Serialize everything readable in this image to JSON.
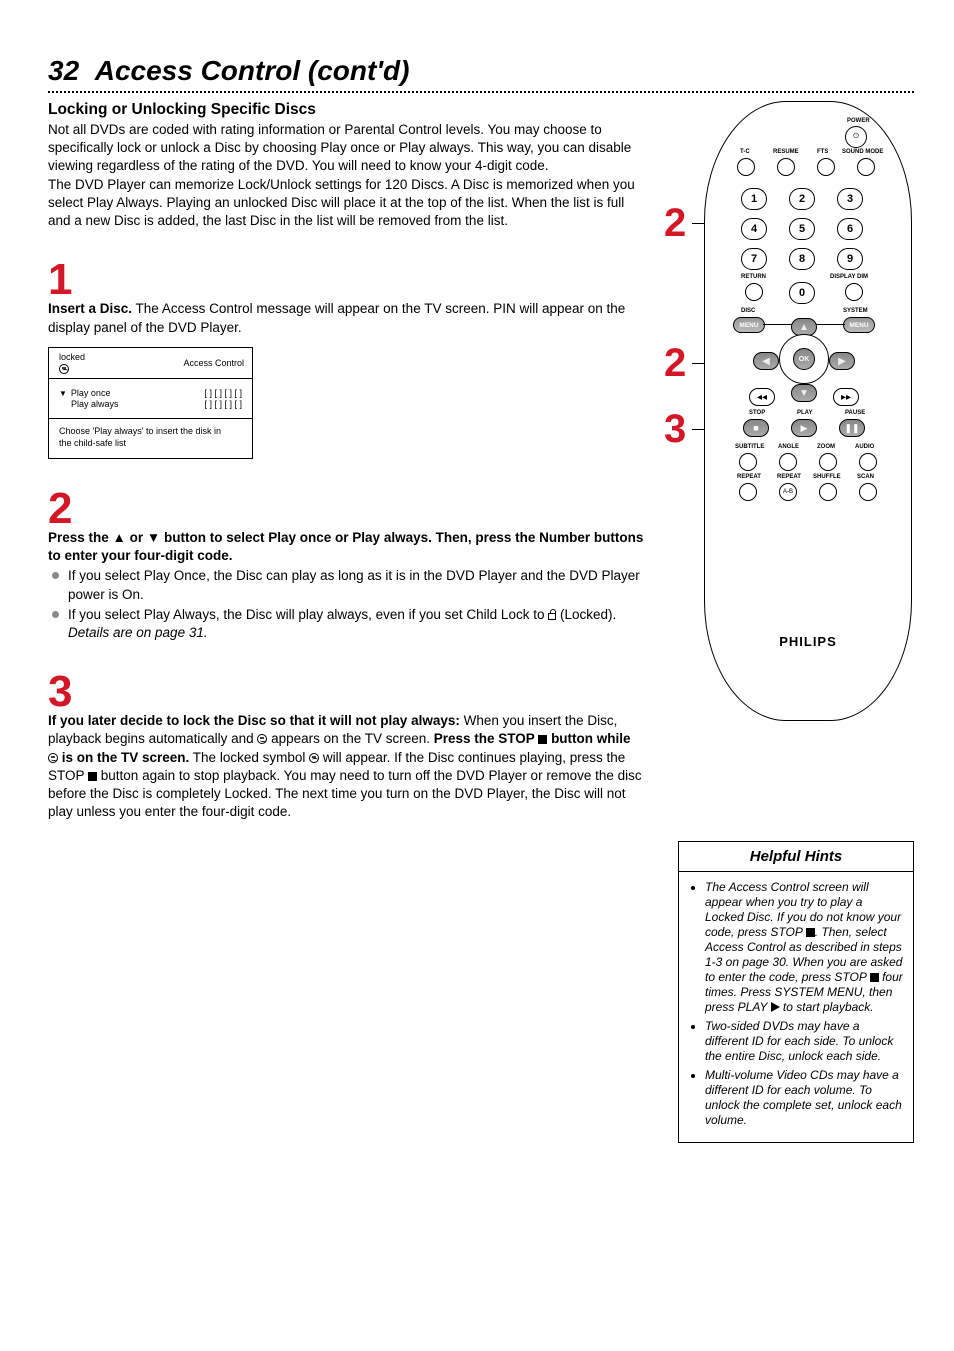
{
  "page": {
    "number": "32",
    "title": "Access Control (cont'd)"
  },
  "heading": "Locking or Unlocking Specific Discs",
  "intro": "Not all DVDs are coded with rating information or Parental Control levels. You may choose to specifically lock or unlock a Disc by choosing Play once or Play always. This way, you can disable viewing regardless of the rating of the DVD. You will need to know your 4-digit code.",
  "intro2": "The DVD Player can memorize Lock/Unlock settings for 120 Discs. A Disc is memorized when you select Play Always. Playing an unlocked Disc will place it at the top of the list. When the list is full and a new Disc is added, the last Disc in the list will be removed from the list.",
  "step1": {
    "num": "1",
    "bold": "Insert a Disc.",
    "text": " The Access Control message will appear on the TV screen. PIN will appear on the display panel of the DVD Player."
  },
  "osd": {
    "topLeft": "locked",
    "topRight": "Access Control",
    "row1a": "Play once",
    "row1b": "[ ]  [ ]  [ ]  [ ]",
    "row2a": "Play always",
    "row2b": "[ ]  [ ]  [ ]  [ ]",
    "bottom1": "Choose 'Play always' to insert the disk in",
    "bottom2": "the child-safe list"
  },
  "step2": {
    "num": "2",
    "boldLine": "Press the ▲ or ▼ button to select Play once or Play always. Then, press the Number buttons to enter your four-digit code.",
    "bullet1": "If you select Play Once, the Disc can play as long as it is in the DVD Player and the DVD Player power is On.",
    "bullet2a": "If you select Play Always, the Disc will play always, even if you set Child Lock to ",
    "bullet2b": " (Locked). ",
    "bullet2c": "Details are on page 31."
  },
  "step3": {
    "num": "3",
    "bold": "If you later decide to lock the Disc so that it will not play always:",
    "line1a": " When you insert the Disc, playback begins automatically and ",
    "line1b": " appears on the TV screen. ",
    "bold2a": "Press the STOP ",
    "bold2b": " button while ",
    "bold2c": " is on the TV screen.",
    "line2a": " The locked symbol ",
    "line2b": " will appear. If the Disc continues playing, press the STOP ",
    "line2c": " button again to stop playback. You may need to turn off the DVD Player or remove the disc before the Disc is completely Locked. The next time you turn on the DVD Player, the Disc will not play unless you enter the four-digit code."
  },
  "hints": {
    "title": "Helpful Hints",
    "h1a": "The Access Control screen will appear when you try to play a Locked Disc. If you do not know your code, press STOP ",
    "h1b": ". Then, select Access Control as described in steps 1-3 on page 30. When you are asked to enter the code, press STOP ",
    "h1c": " four times. Press SYSTEM MENU, then press PLAY ",
    "h1d": " to start playback.",
    "h2": "Two-sided DVDs may have a different ID for each side. To unlock the entire Disc, unlock each side.",
    "h3": "Multi-volume Video CDs may have a different ID for each volume. To unlock the complete set, unlock each volume."
  },
  "remote": {
    "power": "POWER",
    "tc": "T-C",
    "resume": "RESUME",
    "fts": "FTS",
    "soundmode": "SOUND MODE",
    "b1": "1",
    "b2": "2",
    "b3": "3",
    "b4": "4",
    "b5": "5",
    "b6": "6",
    "b7": "7",
    "b8": "8",
    "b9": "9",
    "b0": "0",
    "return": "RETURN",
    "displaydim": "DISPLAY DIM",
    "disc": "DISC",
    "system": "SYSTEM",
    "menu": "MENU",
    "ok": "OK",
    "stop": "STOP",
    "play": "PLAY",
    "pause": "PAUSE",
    "subtitle": "SUBTITLE",
    "angle": "ANGLE",
    "zoom": "ZOOM",
    "audio": "AUDIO",
    "repeat": "REPEAT",
    "repeatab": "REPEAT",
    "shuffle": "SHUFFLE",
    "scan": "SCAN",
    "ab": "A-B",
    "brand": "PHILIPS",
    "callout2": "2",
    "callout2b": "2",
    "callout3": "3"
  }
}
